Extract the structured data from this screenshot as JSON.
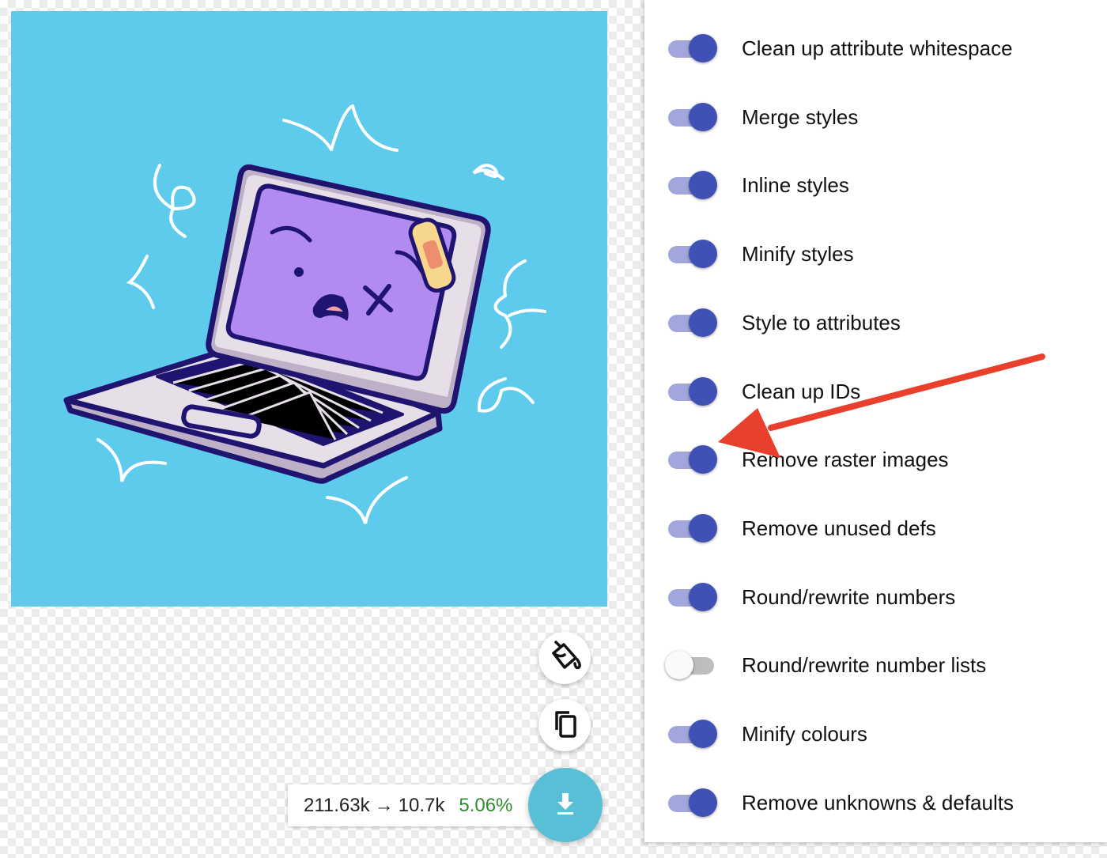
{
  "results": {
    "original_size": "211.63k",
    "arrow": "→",
    "optimized_size": "10.7k",
    "percent": "5.06%"
  },
  "fabs": {
    "background_icon": "paint-bucket-icon",
    "copy_icon": "copy-icon",
    "download_icon": "download-icon"
  },
  "preview": {
    "background_color": "#5ecbec",
    "subject": "laptop-illustration"
  },
  "options": [
    {
      "label": "Clean up attribute whitespace",
      "enabled": true
    },
    {
      "label": "Merge styles",
      "enabled": true
    },
    {
      "label": "Inline styles",
      "enabled": true
    },
    {
      "label": "Minify styles",
      "enabled": true
    },
    {
      "label": "Style to attributes",
      "enabled": true
    },
    {
      "label": "Clean up IDs",
      "enabled": true
    },
    {
      "label": "Remove raster images",
      "enabled": true
    },
    {
      "label": "Remove unused defs",
      "enabled": true
    },
    {
      "label": "Round/rewrite numbers",
      "enabled": true
    },
    {
      "label": "Round/rewrite number lists",
      "enabled": false
    },
    {
      "label": "Minify colours",
      "enabled": true
    },
    {
      "label": "Remove unknowns & defaults",
      "enabled": true
    }
  ],
  "colors": {
    "toggle_on_thumb": "#3f51b5",
    "toggle_on_track": "#a1a6dc",
    "toggle_off_track": "#bdbdbd",
    "download_button": "#58bfd6",
    "percent_text": "#2e8b2e",
    "annotation_arrow": "#e8402c"
  }
}
